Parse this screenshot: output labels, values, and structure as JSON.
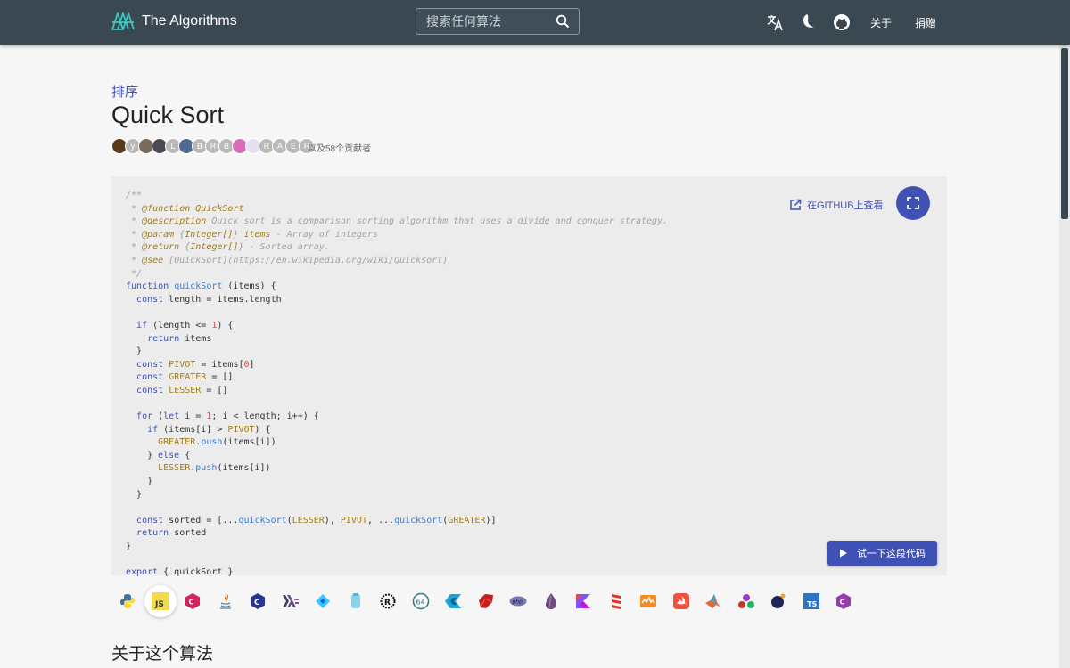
{
  "header": {
    "logo_text": "The Algorithms",
    "search_placeholder": "搜索任何算法",
    "about": "关于",
    "donate": "捐赠"
  },
  "breadcrumb": "排序",
  "title": "Quick Sort",
  "avatar_letters": [
    "y",
    "L",
    "B",
    "R",
    "B",
    "R",
    "A",
    "E",
    "R"
  ],
  "contributors_text": "以及58个贡献者",
  "github_link": "在GITHUB上查看",
  "try_button": "试一下这段代码",
  "section_title": "关于这个算法",
  "languages": [
    "python",
    "javascript",
    "c-plus-plus",
    "java",
    "c",
    "haskell",
    "dart",
    "elm",
    "rust",
    "assembly-64",
    "zig",
    "ruby",
    "php",
    "elixir",
    "kotlin",
    "scala",
    "julia",
    "swift",
    "matlab",
    "r",
    "ocaml",
    "typescript",
    "c-sharp"
  ],
  "active_language": "javascript",
  "colors": {
    "header": "#3a4852",
    "accent": "#3f51b5",
    "code_bg": "#ececec"
  }
}
